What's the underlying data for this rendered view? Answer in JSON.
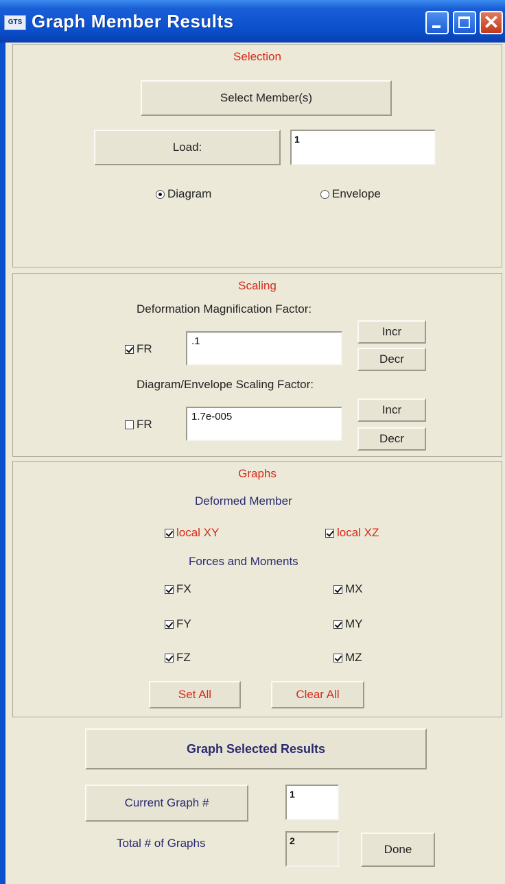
{
  "window": {
    "title": "Graph Member Results",
    "icon_label": "GTS"
  },
  "selection": {
    "title": "Selection",
    "select_members_label": "Select Member(s)",
    "load_label": "Load:",
    "load_value": "1",
    "radio_diagram": "Diagram",
    "radio_envelope": "Envelope",
    "selected_mode": "Diagram"
  },
  "scaling": {
    "title": "Scaling",
    "deformation_label": "Deformation Magnification Factor:",
    "deformation_fr_label": "FR",
    "deformation_fr_checked": true,
    "deformation_value": ".1",
    "diagram_label": "Diagram/Envelope Scaling Factor:",
    "diagram_fr_label": "FR",
    "diagram_fr_checked": false,
    "diagram_value": "1.7e-005",
    "incr_label": "Incr",
    "decr_label": "Decr"
  },
  "graphs": {
    "title": "Graphs",
    "deformed_heading": "Deformed Member",
    "local_xy": "local XY",
    "local_xz": "local XZ",
    "forces_heading": "Forces and Moments",
    "fx": "FX",
    "fy": "FY",
    "fz": "FZ",
    "mx": "MX",
    "my": "MY",
    "mz": "MZ",
    "set_all": "Set All",
    "clear_all": "Clear All"
  },
  "footer": {
    "graph_selected_label": "Graph Selected Results",
    "current_graph_label": "Current Graph #",
    "current_graph_value": "1",
    "total_graphs_label": "Total # of Graphs",
    "total_graphs_value": "2",
    "done_label": "Done"
  }
}
